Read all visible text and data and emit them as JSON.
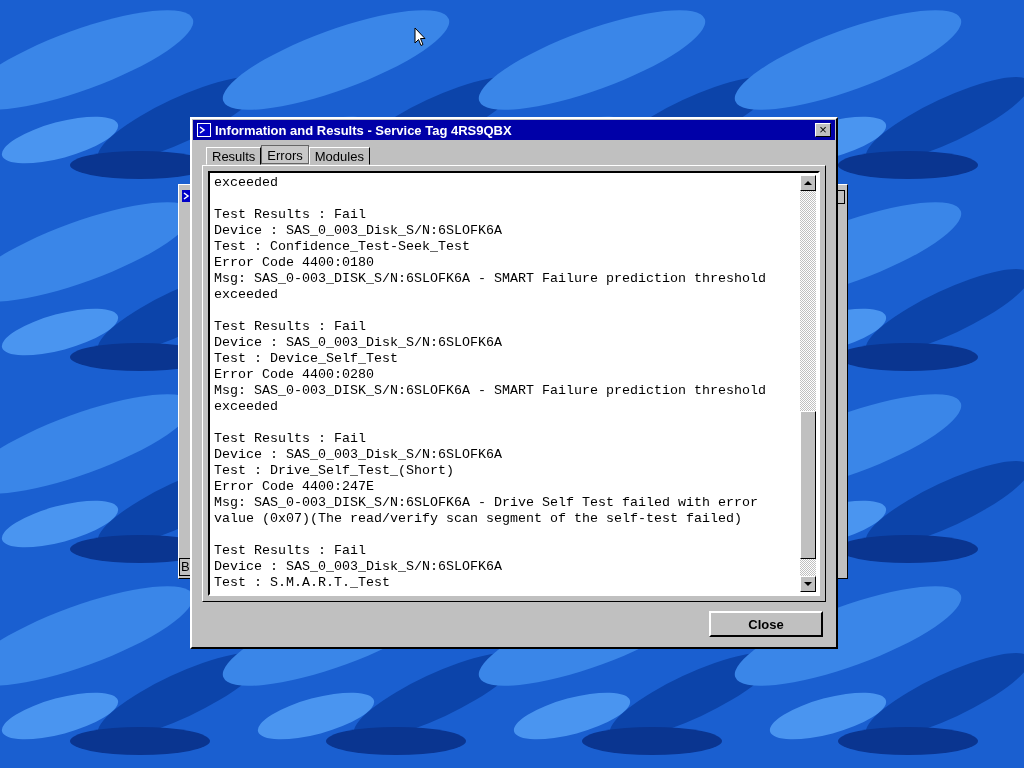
{
  "background_window": {
    "button_label": "B"
  },
  "window": {
    "title": "Information and Results - Service Tag 4RS9QBX",
    "close_glyph": "×"
  },
  "tabs": [
    {
      "label": "Results",
      "selected": false
    },
    {
      "label": "Errors",
      "selected": true
    },
    {
      "label": "Modules",
      "selected": false
    }
  ],
  "log": {
    "entries": [
      {
        "lines": [
          "exceeded"
        ]
      },
      {
        "lines": [
          "Test Results : Fail",
          "Device : SAS_0_003_Disk_S/N:6SLOFK6A",
          "Test : Confidence_Test-Seek_Test",
          "Error Code 4400:0180",
          "Msg: SAS_0-003_DISK_S/N:6SLOFK6A - SMART Failure prediction threshold exceeded"
        ]
      },
      {
        "lines": [
          "Test Results : Fail",
          "Device : SAS_0_003_Disk_S/N:6SLOFK6A",
          "Test : Device_Self_Test",
          "Error Code 4400:0280",
          "Msg: SAS_0-003_DISK_S/N:6SLOFK6A - SMART Failure prediction threshold exceeded"
        ]
      },
      {
        "lines": [
          "Test Results : Fail",
          "Device : SAS_0_003_Disk_S/N:6SLOFK6A",
          "Test : Drive_Self_Test_(Short)",
          "Error Code 4400:247E",
          "Msg: SAS_0-003_DISK_S/N:6SLOFK6A - Drive Self Test failed with error value (0x07)(The read/verify scan segment of the self-test failed)"
        ]
      },
      {
        "lines": [
          "Test Results : Fail",
          "Device : SAS_0_003_Disk_S/N:6SLOFK6A",
          "Test : S.M.A.R.T._Test"
        ]
      }
    ]
  },
  "buttons": [
    {
      "label": "Close"
    }
  ]
}
